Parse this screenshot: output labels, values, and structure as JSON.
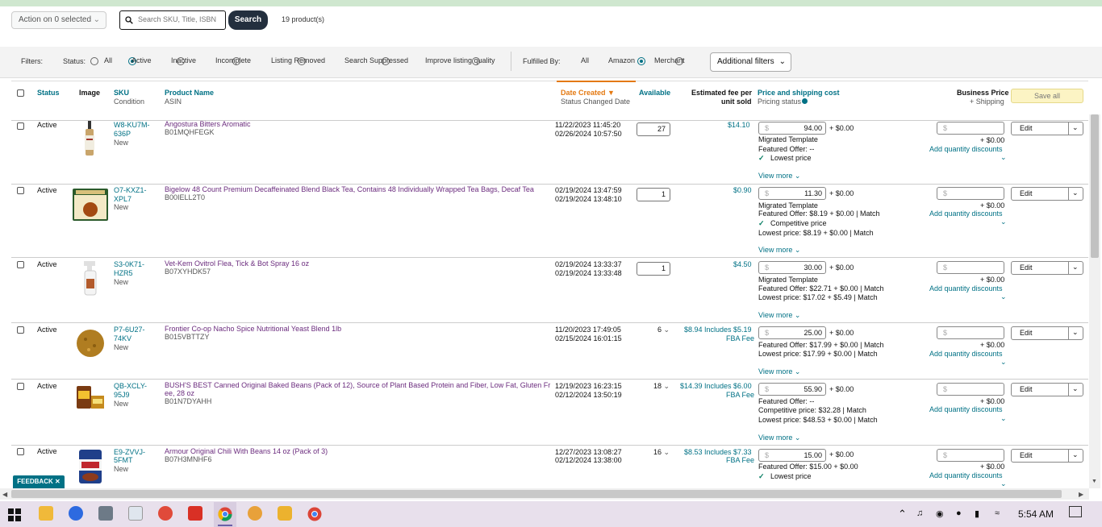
{
  "toolbar": {
    "action_label": "Action on 0 selected",
    "search_placeholder": "Search SKU, Title, ISBN",
    "search_button": "Search",
    "product_count": "19 product(s)"
  },
  "filters": {
    "label": "Filters:",
    "status_label": "Status:",
    "status_options": [
      "All",
      "Active",
      "Inactive",
      "Incomplete",
      "Listing Removed",
      "Search Suppressed",
      "Improve listing quality"
    ],
    "status_selected": "Active",
    "fulfilled_label": "Fulfilled By:",
    "fulfilled_options": [
      "All",
      "Amazon",
      "Merchant"
    ],
    "fulfilled_selected": "All",
    "additional": "Additional filters"
  },
  "header": {
    "status": "Status",
    "image": "Image",
    "sku": "SKU",
    "condition": "Condition",
    "product_name": "Product Name",
    "asin": "ASIN",
    "date_created": "Date Created",
    "status_changed": "Status Changed Date",
    "available": "Available",
    "fee_line1": "Estimated fee per",
    "fee_line2": "unit sold",
    "price": "Price and shipping cost",
    "pricing_status": "Pricing status",
    "business_price": "Business Price",
    "shipping": "+ Shipping",
    "save_all": "Save all"
  },
  "rows": [
    {
      "status": "Active",
      "sku1": "W8-KU7M-",
      "sku2": "636P",
      "condition": "New",
      "name1": "Angostura Bitters Aromatic",
      "name2": "",
      "asin": "B01MQHFEGK",
      "created": "11/22/2023 11:45:20",
      "changed": "02/26/2024 10:57:50",
      "available": "27",
      "fee1": "$14.10",
      "fee2": "",
      "price": "94.00",
      "ship": "+ $0.00",
      "lines": [
        "Migrated Template",
        "Featured Offer: --"
      ],
      "check": "Lowest price",
      "view_more": "View more",
      "bp_ship": "+ $0.00",
      "qty_disc": "Add quantity discounts",
      "edit": "Edit"
    },
    {
      "status": "Active",
      "sku1": "O7-KXZ1-",
      "sku2": "XPL7",
      "condition": "New",
      "name1": "Bigelow 48 Count Premium Decaffeinated Blend Black Tea, Contains 48 Individually Wrapped Tea Bags, Decaf Tea",
      "name2": "",
      "asin": "B00IELL2T0",
      "created": "02/19/2024 13:47:59",
      "changed": "02/19/2024 13:48:10",
      "available": "1",
      "fee1": "$0.90",
      "fee2": "",
      "price": "11.30",
      "ship": "+ $0.00",
      "lines": [
        "Migrated Template",
        "Featured Offer: $8.19 + $0.00 | Match"
      ],
      "check": "Competitive price",
      "extra": "Lowest price: $8.19 + $0.00 | Match",
      "view_more": "View more",
      "bp_ship": "+ $0.00",
      "qty_disc": "Add quantity discounts",
      "edit": "Edit"
    },
    {
      "status": "Active",
      "sku1": "S3-0K71-",
      "sku2": "HZR5",
      "condition": "New",
      "name1": "Vet-Kem Ovitrol Flea, Tick & Bot Spray 16 oz",
      "name2": "",
      "asin": "B07XYHDK57",
      "created": "02/19/2024 13:33:37",
      "changed": "02/19/2024 13:33:48",
      "available": "1",
      "fee1": "$4.50",
      "fee2": "",
      "price": "30.00",
      "ship": "+ $0.00",
      "lines": [
        "Migrated Template",
        "Featured Offer: $22.71 + $0.00 | Match",
        "Lowest price: $17.02 + $5.49 | Match"
      ],
      "view_more": "View more",
      "bp_ship": "+ $0.00",
      "qty_disc": "Add quantity discounts",
      "edit": "Edit"
    },
    {
      "status": "Active",
      "sku1": "P7-6U27-",
      "sku2": "74KV",
      "condition": "New",
      "name1": "Frontier Co-op Nacho Spice Nutritional Yeast Blend 1lb",
      "name2": "",
      "asin": "B015VBTTZY",
      "created": "11/20/2023 17:49:05",
      "changed": "02/15/2024 16:01:15",
      "available": "6",
      "fee1": "$8.94 Includes $5.19",
      "fee2": "FBA Fee",
      "price": "25.00",
      "ship": "+ $0.00",
      "lines": [
        "Featured Offer: $17.99 + $0.00 | Match",
        "Lowest price: $17.99 + $0.00 | Match"
      ],
      "view_more": "View more",
      "bp_ship": "+ $0.00",
      "qty_disc": "Add quantity discounts",
      "edit": "Edit"
    },
    {
      "status": "Active",
      "sku1": "QB-XCLY-",
      "sku2": "95J9",
      "condition": "New",
      "name1": "BUSH'S BEST Canned Original Baked Beans (Pack of 12), Source of Plant Based Protein and Fiber, Low Fat, Gluten Fr",
      "name2": "ee, 28 oz",
      "asin": "B01N7DYAHH",
      "created": "12/19/2023 16:23:15",
      "changed": "02/12/2024 13:50:19",
      "available": "18",
      "fee1": "$14.39 Includes $6.00",
      "fee2": "FBA Fee",
      "price": "55.90",
      "ship": "+ $0.00",
      "lines": [
        "Featured Offer: --",
        "Competitive price: $32.28 | Match",
        "Lowest price: $48.53 + $0.00 | Match"
      ],
      "view_more": "View more",
      "bp_ship": "+ $0.00",
      "qty_disc": "Add quantity discounts",
      "edit": "Edit"
    },
    {
      "status": "Active",
      "sku1": "E9-ZVVJ-",
      "sku2": "5FMT",
      "condition": "New",
      "name1": "Armour Original Chili With Beans 14 oz (Pack of 3)",
      "name2": "",
      "asin": "B07H3MNHF6",
      "created": "12/27/2023 13:08:27",
      "changed": "02/12/2024 13:38:00",
      "available": "16",
      "fee1": "$8.53 Includes $7.33",
      "fee2": "FBA Fee",
      "price": "15.00",
      "ship": "+ $0.00",
      "lines": [
        "Featured Offer: $15.00 + $0.00"
      ],
      "check": "Lowest price",
      "view_more": "",
      "bp_ship": "+ $0.00",
      "qty_disc": "Add quantity discounts",
      "edit": "Edit"
    }
  ],
  "feedback": "FEEDBACK",
  "taskbar": {
    "time": "5:54 AM"
  },
  "colors": {
    "accent": "#007185",
    "link": "#6b2c7e",
    "save_all_bg": "#fcf4c4"
  }
}
